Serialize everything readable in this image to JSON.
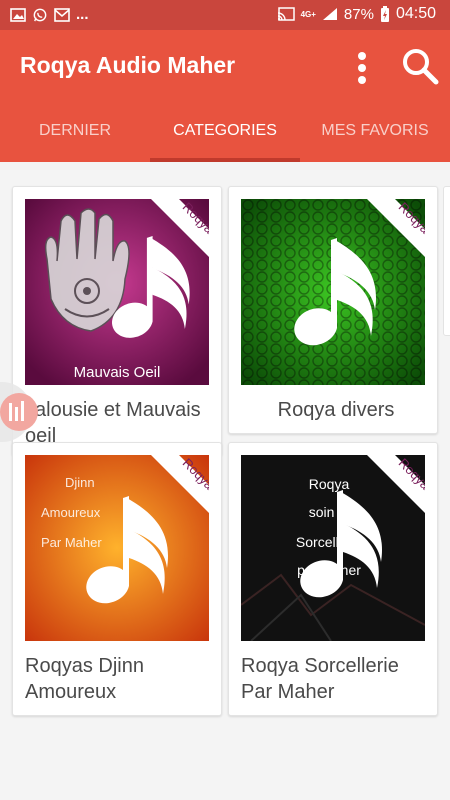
{
  "status_bar": {
    "left_icons": [
      "image-icon",
      "whatsapp-icon",
      "email-icon"
    ],
    "ellipsis": "...",
    "network": "4G+",
    "battery": "87%",
    "time": "04:50"
  },
  "app": {
    "title": "Roqya Audio Maher",
    "colors": {
      "primary": "#e8533f",
      "status": "#c9463d",
      "indicator": "#c03a2c"
    }
  },
  "tabs": [
    {
      "label": "DERNIER",
      "active": false
    },
    {
      "label": "CATEGORIES",
      "active": true
    },
    {
      "label": "MES FAVORIS",
      "active": false
    }
  ],
  "categories": [
    {
      "badge": "Roqya",
      "thumb_text": "Mauvais Oeil",
      "title": "Jalousie et Mauvais oeil"
    },
    {
      "badge": "Roqya",
      "thumb_text": "",
      "title": "Roqya divers"
    },
    {
      "badge": "Roqya",
      "thumb_text": "Djinn Amoureux Par Maher",
      "title": "Roqyas Djinn Amoureux"
    },
    {
      "badge": "Roqya",
      "thumb_text": "Roqya soin la Sorcellerie par Maher",
      "title": "Roqya Sorcellerie Par Maher"
    }
  ],
  "thumb_lines": {
    "djinn": [
      "Djinn",
      "Amoureux",
      "Par Maher"
    ],
    "sorc": [
      "Roqya",
      "soin la",
      "Sorcellerie",
      "par Maher"
    ]
  }
}
